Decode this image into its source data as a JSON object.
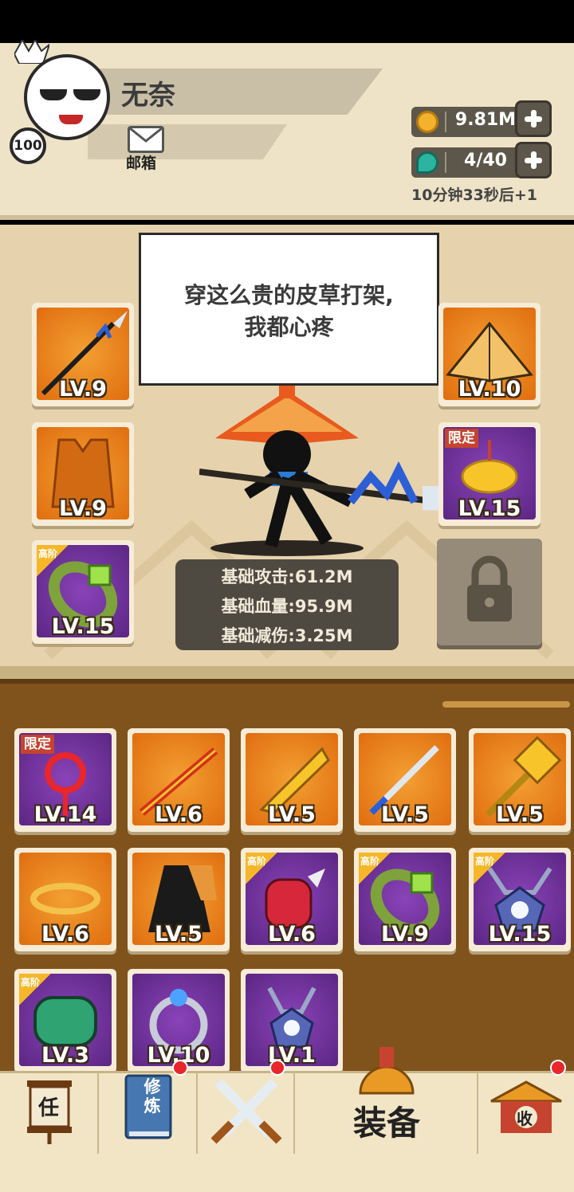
{
  "player": {
    "name": "无奈",
    "level": "100",
    "mail_label": "邮箱"
  },
  "resources": {
    "coins": "9.81M",
    "energy": "4/40",
    "timer": "10分钟33秒后+1"
  },
  "speech_lines": [
    "穿这么贵的皮草打架,",
    "我都心疼"
  ],
  "equipped": {
    "weapon_lv": "LV.9",
    "armor_lv": "LV.9",
    "ring_lv": "LV.15",
    "ring_tag": "高阶",
    "hat_lv": "LV.10",
    "accessory_lv": "LV.15",
    "accessory_tag": "限定"
  },
  "stats": {
    "attack": "基础攻击:61.2M",
    "hp": "基础血量:95.9M",
    "defense": "基础减伤:3.25M"
  },
  "inventory": [
    {
      "lv": "LV.14",
      "rarity": "purple",
      "tag": "限定",
      "icon": "chinese-knot-icon"
    },
    {
      "lv": "LV.6",
      "rarity": "orange",
      "tag": "",
      "icon": "staff-icon"
    },
    {
      "lv": "LV.5",
      "rarity": "orange",
      "tag": "",
      "icon": "broadsword-icon"
    },
    {
      "lv": "LV.5",
      "rarity": "orange",
      "tag": "",
      "icon": "sword-icon"
    },
    {
      "lv": "LV.5",
      "rarity": "orange",
      "tag": "",
      "icon": "hammer-icon"
    },
    {
      "lv": "LV.6",
      "rarity": "orange",
      "tag": "",
      "icon": "headband-icon"
    },
    {
      "lv": "LV.5",
      "rarity": "orange",
      "tag": "",
      "icon": "cloak-icon"
    },
    {
      "lv": "LV.6",
      "rarity": "purple",
      "tag": "高阶",
      "icon": "spiked-gauntlet-icon"
    },
    {
      "lv": "LV.9",
      "rarity": "purple",
      "tag": "高阶",
      "icon": "jade-bracelet-icon"
    },
    {
      "lv": "LV.15",
      "rarity": "purple",
      "tag": "高阶",
      "icon": "amulet-icon"
    },
    {
      "lv": "LV.3",
      "rarity": "purple",
      "tag": "高阶",
      "icon": "bracer-icon"
    },
    {
      "lv": "LV.10",
      "rarity": "purple",
      "tag": "",
      "icon": "gem-ring-icon"
    },
    {
      "lv": "LV.1",
      "rarity": "purple",
      "tag": "",
      "icon": "necklace-icon"
    }
  ],
  "nav": {
    "task_char": "任",
    "cultivate_chars": "修炼",
    "equip_label": "装备",
    "collect_char": "收"
  },
  "colors": {
    "orange_bg": "#e06d0f",
    "purple_bg": "#5b2683",
    "inventory_bg": "#80531d",
    "header_bg": "#efe3c7",
    "notification_dot": "#e8262b"
  }
}
